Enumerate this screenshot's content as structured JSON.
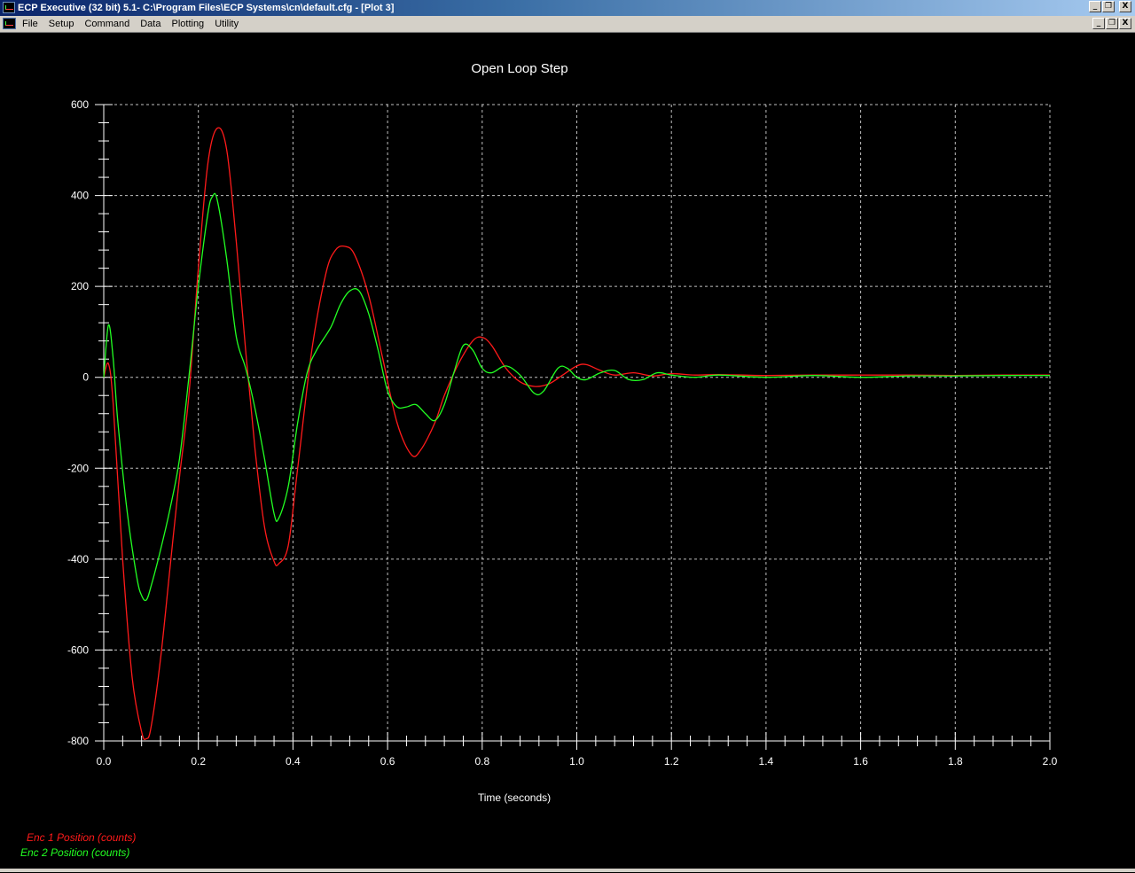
{
  "window": {
    "title": "ECP Executive (32 bit) 5.1- C:\\Program Files\\ECP Systems\\cn\\default.cfg - [Plot 3]",
    "controls": [
      "_",
      "❐",
      "X"
    ]
  },
  "menubar": {
    "items": [
      "File",
      "Setup",
      "Command",
      "Data",
      "Plotting",
      "Utility"
    ],
    "controls": [
      "_",
      "❐",
      "X"
    ]
  },
  "colors": {
    "background": "#000000",
    "grid": "#ffffff",
    "enc1": "#ff1a1a",
    "enc2": "#22ff22",
    "text": "#ffffff"
  },
  "chart_data": {
    "type": "line",
    "title": "Open Loop Step",
    "xlabel": "Time (seconds)",
    "ylabel": "",
    "xlim": [
      0,
      2.0
    ],
    "ylim": [
      -800,
      600
    ],
    "xticks": [
      "0.0",
      "0.2",
      "0.4",
      "0.6",
      "0.8",
      "1.0",
      "1.2",
      "1.4",
      "1.6",
      "1.8",
      "2.0"
    ],
    "yticks": [
      "600",
      "400",
      "200",
      "0",
      "-200",
      "-400",
      "-600",
      "-800"
    ],
    "grid": true,
    "legend_position": "bottom-left",
    "series": [
      {
        "name": "Enc 1 Position (counts)",
        "color": "#ff1a1a",
        "points": [
          [
            0,
            0
          ],
          [
            0.01,
            30
          ],
          [
            0.02,
            -60
          ],
          [
            0.04,
            -400
          ],
          [
            0.06,
            -660
          ],
          [
            0.08,
            -780
          ],
          [
            0.09,
            -795
          ],
          [
            0.1,
            -770
          ],
          [
            0.12,
            -620
          ],
          [
            0.14,
            -420
          ],
          [
            0.16,
            -220
          ],
          [
            0.18,
            -40
          ],
          [
            0.2,
            240
          ],
          [
            0.22,
            470
          ],
          [
            0.24,
            548
          ],
          [
            0.26,
            500
          ],
          [
            0.28,
            300
          ],
          [
            0.3,
            60
          ],
          [
            0.32,
            -160
          ],
          [
            0.34,
            -330
          ],
          [
            0.36,
            -405
          ],
          [
            0.37,
            -410
          ],
          [
            0.39,
            -370
          ],
          [
            0.41,
            -200
          ],
          [
            0.44,
            60
          ],
          [
            0.47,
            230
          ],
          [
            0.49,
            280
          ],
          [
            0.51,
            288
          ],
          [
            0.53,
            270
          ],
          [
            0.56,
            180
          ],
          [
            0.59,
            40
          ],
          [
            0.62,
            -100
          ],
          [
            0.65,
            -170
          ],
          [
            0.67,
            -160
          ],
          [
            0.7,
            -100
          ],
          [
            0.72,
            -40
          ],
          [
            0.75,
            30
          ],
          [
            0.78,
            80
          ],
          [
            0.8,
            88
          ],
          [
            0.82,
            70
          ],
          [
            0.85,
            20
          ],
          [
            0.88,
            -10
          ],
          [
            0.91,
            -20
          ],
          [
            0.94,
            -15
          ],
          [
            0.97,
            5
          ],
          [
            1.0,
            25
          ],
          [
            1.02,
            28
          ],
          [
            1.05,
            15
          ],
          [
            1.08,
            5
          ],
          [
            1.12,
            10
          ],
          [
            1.16,
            3
          ],
          [
            1.2,
            8
          ],
          [
            1.25,
            5
          ],
          [
            1.3,
            6
          ],
          [
            1.4,
            4
          ],
          [
            1.5,
            5
          ],
          [
            1.6,
            5
          ],
          [
            1.7,
            5
          ],
          [
            1.8,
            4
          ],
          [
            1.9,
            5
          ],
          [
            2.0,
            5
          ]
        ]
      },
      {
        "name": "Enc 2 Position (counts)",
        "color": "#22ff22",
        "points": [
          [
            0,
            0
          ],
          [
            0.01,
            115
          ],
          [
            0.02,
            40
          ],
          [
            0.03,
            -100
          ],
          [
            0.05,
            -300
          ],
          [
            0.07,
            -440
          ],
          [
            0.08,
            -480
          ],
          [
            0.09,
            -490
          ],
          [
            0.1,
            -460
          ],
          [
            0.12,
            -380
          ],
          [
            0.14,
            -290
          ],
          [
            0.16,
            -180
          ],
          [
            0.18,
            0
          ],
          [
            0.2,
            200
          ],
          [
            0.22,
            360
          ],
          [
            0.23,
            398
          ],
          [
            0.24,
            390
          ],
          [
            0.26,
            260
          ],
          [
            0.28,
            90
          ],
          [
            0.3,
            20
          ],
          [
            0.32,
            -70
          ],
          [
            0.34,
            -180
          ],
          [
            0.36,
            -300
          ],
          [
            0.37,
            -310
          ],
          [
            0.39,
            -240
          ],
          [
            0.41,
            -100
          ],
          [
            0.43,
            10
          ],
          [
            0.45,
            60
          ],
          [
            0.48,
            110
          ],
          [
            0.5,
            160
          ],
          [
            0.52,
            190
          ],
          [
            0.54,
            190
          ],
          [
            0.56,
            140
          ],
          [
            0.58,
            60
          ],
          [
            0.6,
            -30
          ],
          [
            0.62,
            -65
          ],
          [
            0.64,
            -65
          ],
          [
            0.66,
            -60
          ],
          [
            0.68,
            -80
          ],
          [
            0.7,
            -95
          ],
          [
            0.72,
            -60
          ],
          [
            0.74,
            10
          ],
          [
            0.76,
            70
          ],
          [
            0.78,
            60
          ],
          [
            0.8,
            20
          ],
          [
            0.82,
            10
          ],
          [
            0.85,
            25
          ],
          [
            0.88,
            5
          ],
          [
            0.91,
            -35
          ],
          [
            0.93,
            -30
          ],
          [
            0.96,
            20
          ],
          [
            0.98,
            20
          ],
          [
            1.0,
            0
          ],
          [
            1.02,
            -5
          ],
          [
            1.05,
            10
          ],
          [
            1.08,
            15
          ],
          [
            1.11,
            -5
          ],
          [
            1.14,
            -5
          ],
          [
            1.17,
            10
          ],
          [
            1.2,
            5
          ],
          [
            1.25,
            0
          ],
          [
            1.3,
            5
          ],
          [
            1.4,
            0
          ],
          [
            1.5,
            4
          ],
          [
            1.6,
            0
          ],
          [
            1.7,
            3
          ],
          [
            1.8,
            3
          ],
          [
            1.9,
            4
          ],
          [
            2.0,
            4
          ]
        ]
      }
    ]
  }
}
